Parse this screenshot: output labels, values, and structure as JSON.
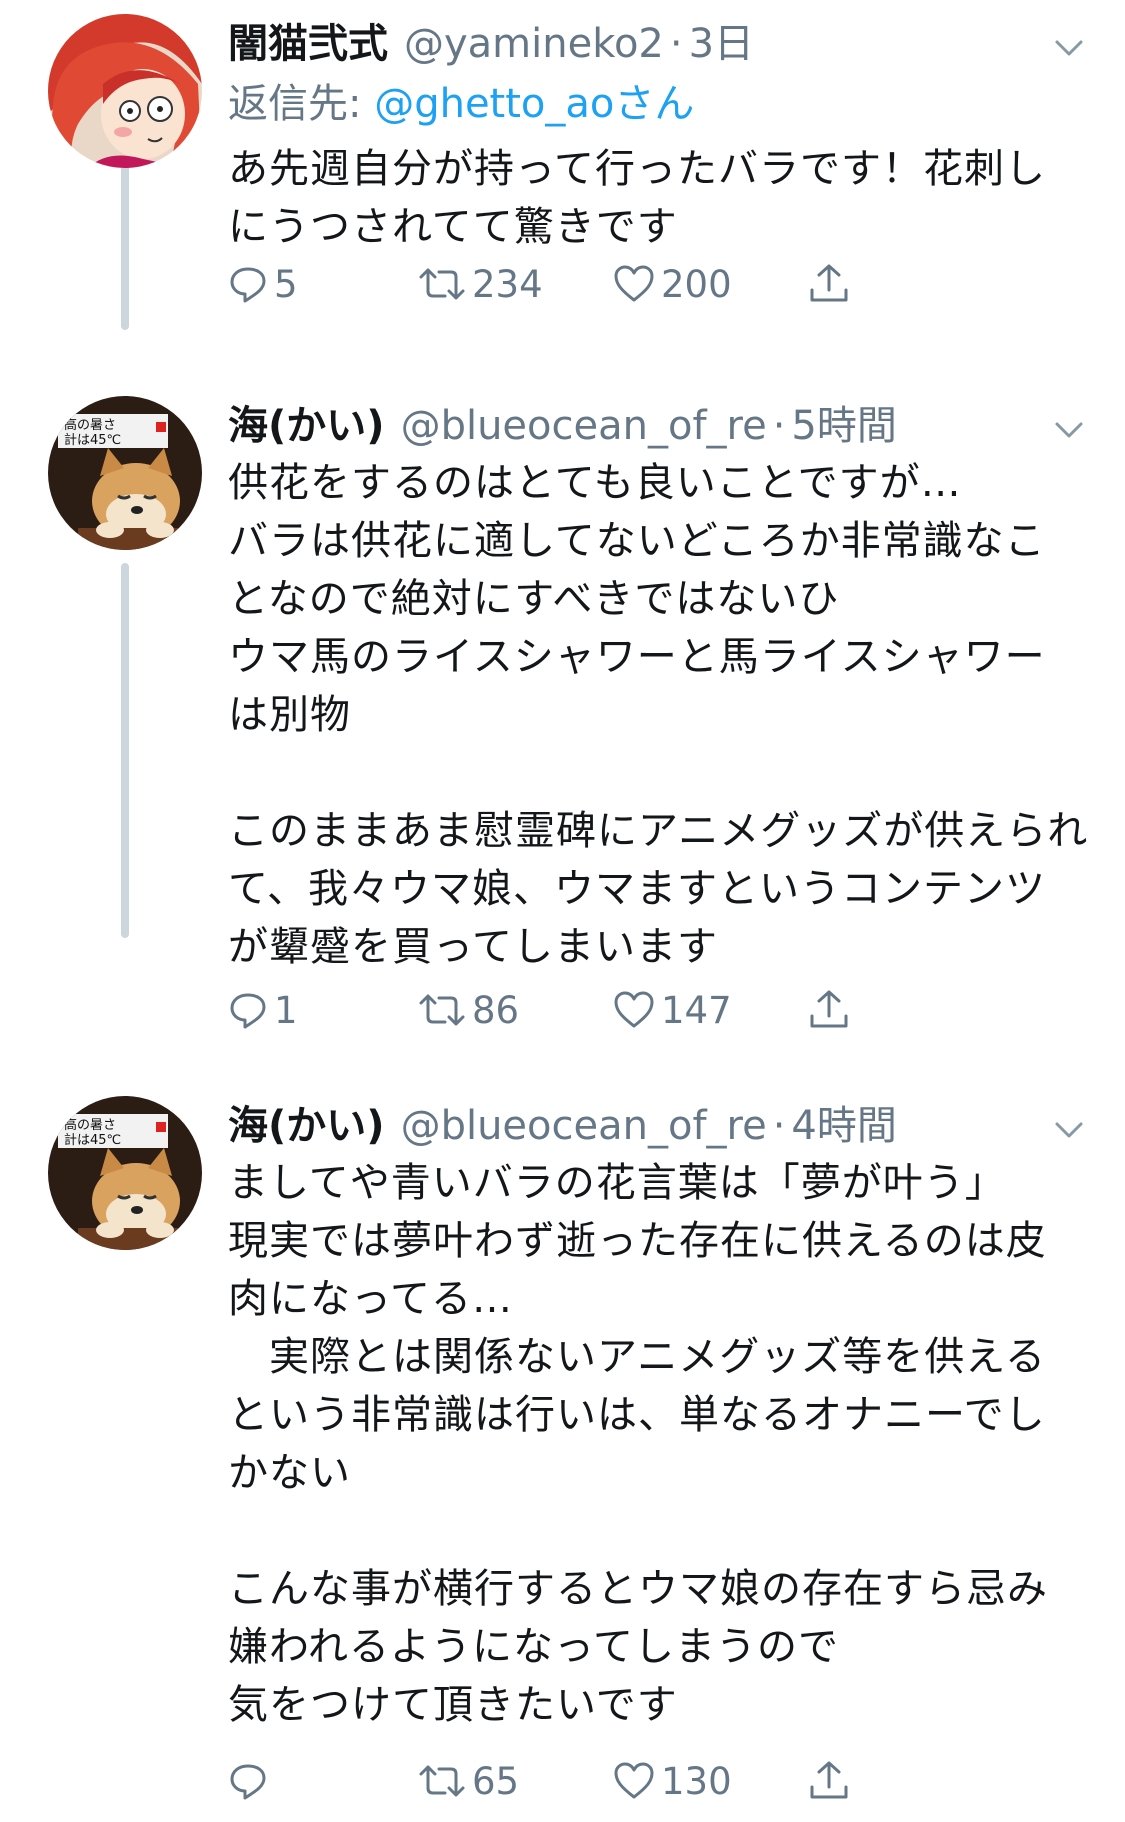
{
  "tweets": [
    {
      "name": "闇猫弐式",
      "handle": "@yamineko2",
      "time": "3日",
      "reply_prefix": "返信先: ",
      "reply_mention": "@ghetto_aoさん",
      "text": "あ先週自分が持って行ったバラです！花刺し\nにうつされてて驚きです",
      "replies": "5",
      "retweets": "234",
      "likes": "200"
    },
    {
      "name": "海(かい)",
      "handle": "@blueocean_of_re",
      "time": "5時間",
      "text": "供花をするのはとても良いことですが…\nバラは供花に適してないどころか非常識なこ\nとなので絶対にすべきではないひ\nウマ馬のライスシャワーと馬ライスシャワー\nは別物\n\nこのままあま慰霊碑にアニメグッズが供えられ\nて、我々ウマ娘、ウマますというコンテンツ\nが顰蹙を買ってしまいます",
      "replies": "1",
      "retweets": "86",
      "likes": "147"
    },
    {
      "name": "海(かい)",
      "handle": "@blueocean_of_re",
      "time": "4時間",
      "text": "ましてや青いバラの花言葉は「夢が叶う」\n現実では夢叶わず逝った存在に供えるのは皮\n肉になってる…\n　実際とは関係ないアニメグッズ等を供える\nという非常識は行いは、単なるオナニーでし\nかない\n\nこんな事が横行するとウマ娘の存在すら忌み\n嫌われるようになってしまうので\n気をつけて頂きたいです",
      "replies": "",
      "retweets": "65",
      "likes": "130"
    }
  ],
  "avatar_caption_line1": "高の暑さ",
  "avatar_caption_line2": "計は45℃",
  "icons": [
    "reply-icon",
    "retweet-icon",
    "like-icon",
    "share-icon",
    "chevron-down-icon"
  ],
  "colors": {
    "text": "#14171a",
    "secondary": "#657786",
    "link": "#1da1f2",
    "thread_line": "#ccd6dd"
  }
}
